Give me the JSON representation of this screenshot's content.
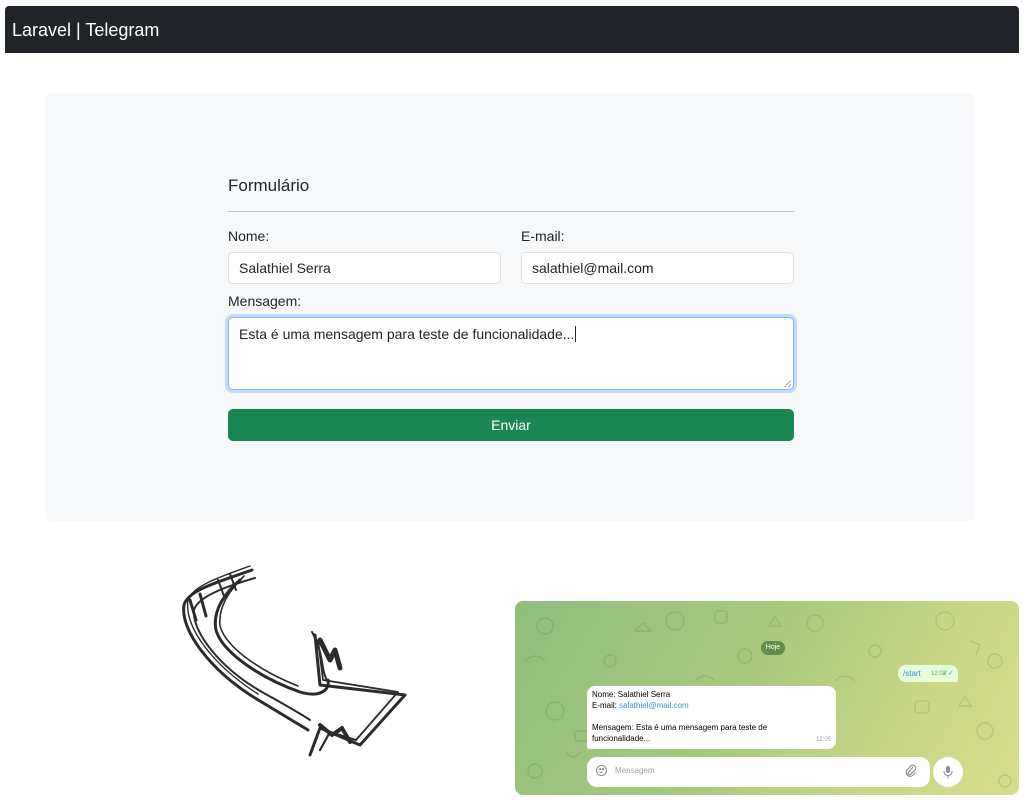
{
  "navbar": {
    "brand": "Laravel | Telegram"
  },
  "form": {
    "title": "Formulário",
    "name_label": "Nome:",
    "name_value": "Salathiel Serra",
    "email_label": "E-mail:",
    "email_value": "salathiel@mail.com",
    "message_label": "Mensagem:",
    "message_value": "Esta é uma mensagem para teste de funcionalidade...",
    "submit_label": "Enviar"
  },
  "telegram": {
    "date_badge": "Hoje",
    "outgoing": {
      "text": "/start",
      "time": "12:03",
      "status": "read"
    },
    "incoming": {
      "name_line": "Nome: Salathiel Serra",
      "email_prefix": "E-mail:",
      "email_link": "salathiel@mail.com",
      "message_line1": "Mensagem: Esta é uma mensagem para teste de",
      "message_line2": "funcionalidade...",
      "time": "12:05"
    },
    "composer_placeholder": "Mensagem"
  },
  "colors": {
    "navbar_bg": "#212529",
    "card_bg": "#f8f9fa",
    "submit_bg": "#198754",
    "link": "#3a8fd1"
  },
  "icons": [
    "arrow-icon",
    "emoji-icon",
    "paperclip-icon",
    "microphone-icon",
    "double-check-icon"
  ]
}
